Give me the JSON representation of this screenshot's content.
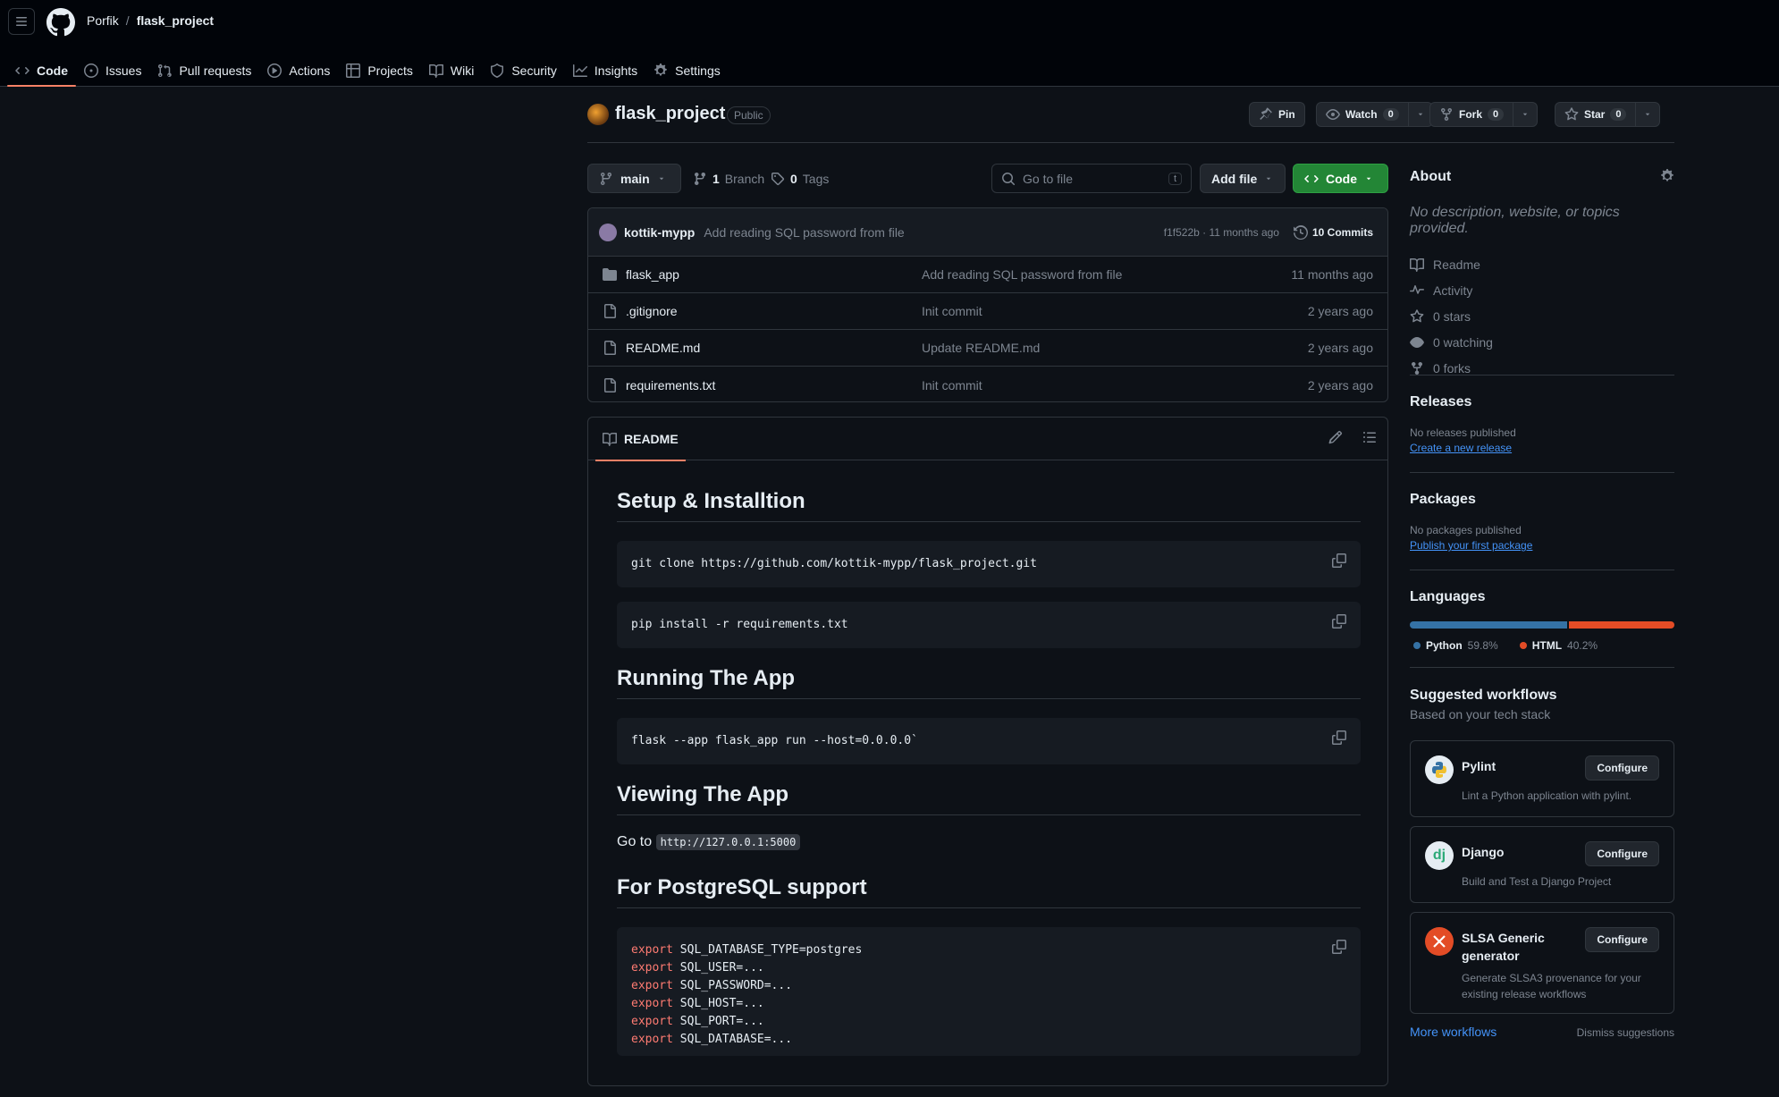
{
  "breadcrumb": {
    "owner": "Porfik",
    "separator": "/",
    "repo": "flask_project"
  },
  "nav_tabs": [
    {
      "label": "Code",
      "icon": "code-icon",
      "active": true
    },
    {
      "label": "Issues",
      "icon": "issue-icon"
    },
    {
      "label": "Pull requests",
      "icon": "pull-request-icon"
    },
    {
      "label": "Actions",
      "icon": "play-icon"
    },
    {
      "label": "Projects",
      "icon": "table-icon"
    },
    {
      "label": "Wiki",
      "icon": "book-icon"
    },
    {
      "label": "Security",
      "icon": "shield-icon"
    },
    {
      "label": "Insights",
      "icon": "graph-icon"
    },
    {
      "label": "Settings",
      "icon": "gear-icon"
    }
  ],
  "repo": {
    "name": "flask_project",
    "visibility": "Public",
    "pin_label": "Pin",
    "watch_label": "Watch",
    "watch_count": "0",
    "fork_label": "Fork",
    "fork_count": "0",
    "star_label": "Star",
    "star_count": "0"
  },
  "branchbar": {
    "branch": "main",
    "branches_count": "1",
    "branches_label": "Branch",
    "tags_count": "0",
    "tags_label": "Tags",
    "search_placeholder": "Go to file",
    "search_shortcut": "t",
    "add_file_label": "Add file",
    "code_label": "Code"
  },
  "latest_commit": {
    "author": "kottik-mypp",
    "message": "Add reading SQL password from file",
    "meta": "f1f522b · 11 months ago",
    "commits_label": "10 Commits"
  },
  "files": [
    {
      "name": "flask_app",
      "type": "folder",
      "message": "Add reading SQL password from file",
      "date": "11 months ago"
    },
    {
      "name": ".gitignore",
      "type": "file",
      "message": "Init commit",
      "date": "2 years ago"
    },
    {
      "name": "README.md",
      "type": "file",
      "message": "Update README.md",
      "date": "2 years ago"
    },
    {
      "name": "requirements.txt",
      "type": "file",
      "message": "Init commit",
      "date": "2 years ago"
    }
  ],
  "readme": {
    "tab_label": "README",
    "h_setup": "Setup & Installtion",
    "code_clone": "git clone https://github.com/kottik-mypp/flask_project.git",
    "code_pip": "pip install -r requirements.txt",
    "h_running": "Running The App",
    "code_run": "flask --app flask_app run --host=0.0.0.0`",
    "h_viewing": "Viewing The App",
    "goto_text": "Go to",
    "goto_url": "http://127.0.0.1:5000",
    "h_postgres": "For PostgreSQL support",
    "export_keyword": "export",
    "exports": [
      "SQL_DATABASE_TYPE=postgres",
      "SQL_USER=...",
      "SQL_PASSWORD=...",
      "SQL_HOST=...",
      "SQL_PORT=...",
      "SQL_DATABASE=..."
    ]
  },
  "about": {
    "title": "About",
    "description": "No description, website, or topics provided.",
    "items": [
      {
        "label": "Readme",
        "icon": "book-icon"
      },
      {
        "label": "Activity",
        "icon": "pulse-icon"
      },
      {
        "label": "0 stars",
        "icon": "star-icon"
      },
      {
        "label": "0 watching",
        "icon": "eye-icon"
      },
      {
        "label": "0 forks",
        "icon": "fork-icon"
      }
    ]
  },
  "releases": {
    "title": "Releases",
    "text": "No releases published",
    "link": "Create a new release"
  },
  "packages": {
    "title": "Packages",
    "text": "No packages published",
    "link": "Publish your first package"
  },
  "languages": {
    "title": "Languages",
    "items": [
      {
        "name": "Python",
        "percent": "59.8%",
        "value": 59.8,
        "color": "#3572a5"
      },
      {
        "name": "HTML",
        "percent": "40.2%",
        "value": 40.2,
        "color": "#e34c26"
      }
    ]
  },
  "workflows": {
    "title": "Suggested workflows",
    "subtitle": "Based on your tech stack",
    "configure_label": "Configure",
    "items": [
      {
        "name": "Pylint",
        "desc": "Lint a Python application with pylint."
      },
      {
        "name": "Django",
        "desc": "Build and Test a Django Project"
      },
      {
        "name": "SLSA Generic generator",
        "desc": "Generate SLSA3 provenance for your existing release workflows"
      }
    ],
    "more_label": "More workflows",
    "dismiss_label": "Dismiss suggestions"
  },
  "colors": {
    "accent_tab": "#f78166",
    "primary_button": "#238636",
    "link": "#4493f8"
  }
}
